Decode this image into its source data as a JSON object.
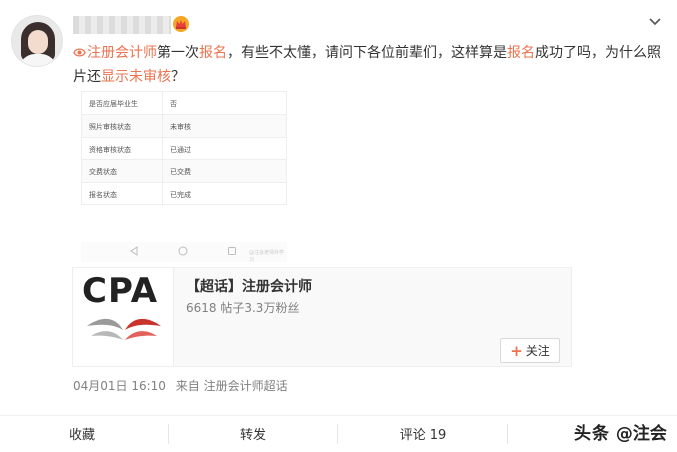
{
  "post": {
    "text": {
      "topic": "注册会计师",
      "part1": "第一次",
      "link1": "报名",
      "part2": "，有些不太懂，请问下各位前辈们，这样算是",
      "link2": "报名",
      "part3": "成功了吗，为什么照片还",
      "link3": "显示未审核",
      "part4": "？"
    },
    "screenshot": {
      "rows": [
        {
          "label": "是否应届毕业生",
          "value": "否"
        },
        {
          "label": "照片审核状态",
          "value": "未审核"
        },
        {
          "label": "资格审核状态",
          "value": "已通过"
        },
        {
          "label": "交费状态",
          "value": "已交费"
        },
        {
          "label": "报名状态",
          "value": "已完成"
        }
      ],
      "nav_watermark": "@注会老师外学习"
    },
    "card": {
      "logo_text": "CPA",
      "title": "【超话】注册会计师",
      "meta": "6618 帖子3.3万粉丝",
      "follow_label": "关注"
    },
    "time": "04月01日 16:10",
    "source": "来自 注册会计师超话"
  },
  "actions": {
    "favorite": "收藏",
    "repost": "转发",
    "comment": "评论",
    "comment_count": "19"
  },
  "watermark": {
    "brand": "头条",
    "handle": "@注会"
  },
  "colors": {
    "link": "#eb7350",
    "meta": "#808080",
    "crown": "#f5a623",
    "wing_red": "#c9332b",
    "wing_gray": "#9a9a9a"
  }
}
